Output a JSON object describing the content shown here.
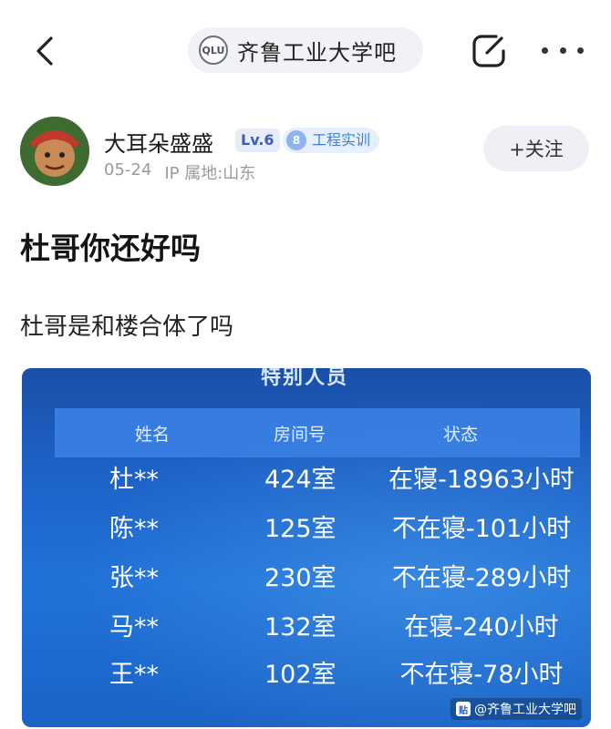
{
  "header": {
    "forum_name": "齐鲁工业大学吧",
    "forum_logo_text": "QLU",
    "icons": [
      "back-arrow-icon",
      "share-icon",
      "more-icon"
    ]
  },
  "author": {
    "name": "大耳朵盛盛",
    "level": "Lv.6",
    "tag_number": "8",
    "tag_label": "工程实训",
    "date": "05-24",
    "ip_location": "IP 属地:山东",
    "follow_label": "+关注"
  },
  "post": {
    "title": "杜哥你还好吗",
    "text": "杜哥是和楼合体了吗"
  },
  "screen": {
    "title": "特别人员",
    "columns": [
      "姓名",
      "房间号",
      "状态"
    ],
    "rows": [
      {
        "name": "杜**",
        "room": "424室",
        "status": "在寝-18963小时"
      },
      {
        "name": "陈**",
        "room": "125室",
        "status": "不在寝-101小时"
      },
      {
        "name": "张**",
        "room": "230室",
        "status": "不在寝-289小时"
      },
      {
        "name": "马**",
        "room": "132室",
        "status": "在寝-240小时"
      },
      {
        "name": "王**",
        "room": "102室",
        "status": "不在寝-78小时"
      }
    ],
    "watermark": "@齐鲁工业大学吧"
  },
  "colors": {
    "accent_blue": "#3f7fd8",
    "screen_blue": "#1d63c8",
    "pill_bg": "#f1f2f5"
  }
}
